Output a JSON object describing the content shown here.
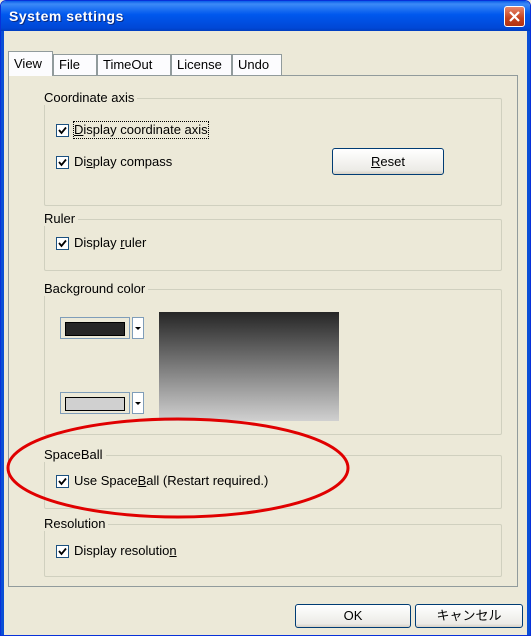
{
  "window": {
    "title": "System settings"
  },
  "tabs": [
    {
      "label": "View",
      "active": true
    },
    {
      "label": "File",
      "active": false
    },
    {
      "label": "TimeOut",
      "active": false
    },
    {
      "label": "License",
      "active": false
    },
    {
      "label": "Undo",
      "active": false
    }
  ],
  "coordinate_axis": {
    "legend": "Coordinate axis",
    "display_axis": {
      "pre": "",
      "key": "D",
      "post": "isplay coordinate axis",
      "checked": true
    },
    "display_compass": {
      "pre": "Di",
      "key": "s",
      "post": "play compass",
      "checked": true
    },
    "reset": {
      "key": "R",
      "post": "eset"
    }
  },
  "ruler": {
    "legend": "Ruler",
    "display_ruler": {
      "pre": "Display ",
      "key": "r",
      "post": "uler",
      "checked": true
    }
  },
  "background_color": {
    "legend": "Background color",
    "top_color": "#262626",
    "bottom_color": "#d0d0d0"
  },
  "spaceball": {
    "legend": "SpaceBall",
    "use_spaceball": {
      "pre": "Use Space",
      "key": "B",
      "post": "all (Restart required.)",
      "checked": true
    }
  },
  "resolution": {
    "legend": "Resolution",
    "display_resolution": {
      "pre": "Display resolutio",
      "key": "n",
      "post": "",
      "checked": true
    }
  },
  "footer": {
    "ok": "OK",
    "cancel": "キャンセル"
  },
  "colors": {
    "annotation": "#e00000",
    "titlebar": "#0058ee"
  }
}
